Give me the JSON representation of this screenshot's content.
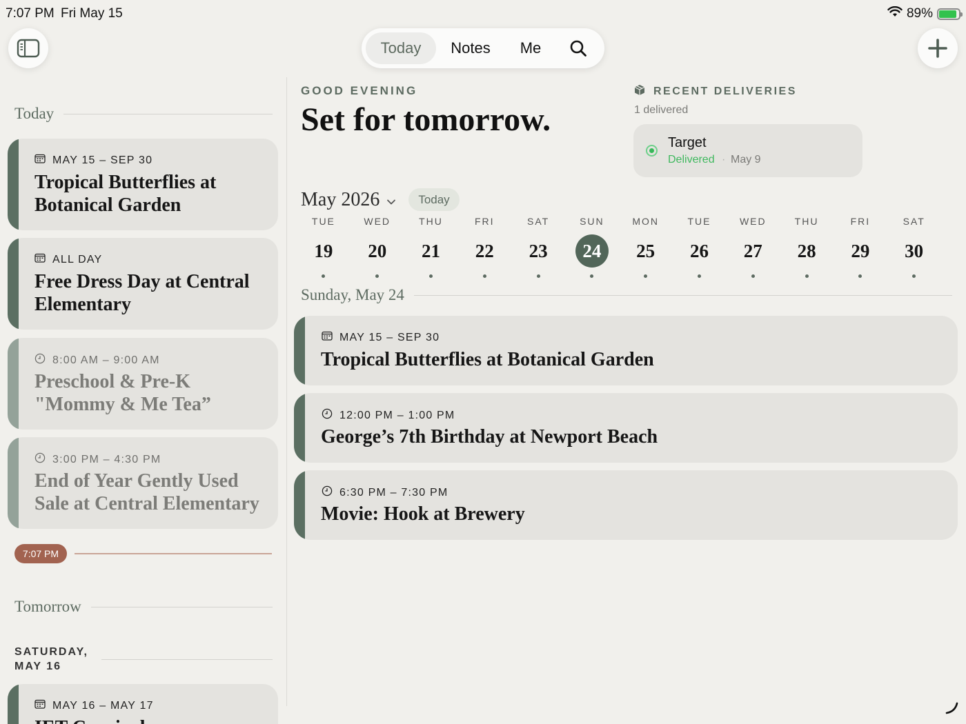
{
  "status": {
    "time": "7:07 PM",
    "date": "Fri May 15",
    "battery": "89%",
    "battery_level": 0.89
  },
  "topnav": {
    "tabs": [
      {
        "label": "Today"
      },
      {
        "label": "Notes"
      },
      {
        "label": "Me"
      }
    ]
  },
  "sidebar": {
    "today_label": "Today",
    "cards": [
      {
        "meta": "MAY 15 – SEP 30",
        "title": "Tropical Butterflies at Botanical Garden"
      },
      {
        "meta": "ALL DAY",
        "title": "Free Dress Day at Central Elementary"
      },
      {
        "meta": "8:00 AM – 9:00 AM",
        "title": "Preschool & Pre-K \"Mommy & Me Tea”"
      },
      {
        "meta": "3:00 PM – 4:30 PM",
        "title": "End of Year Gently Used Sale at Central Elementary"
      }
    ],
    "now_time": "7:07 PM",
    "tomorrow_label": "Tomorrow",
    "day_label": "SATURDAY, MAY 16",
    "next_card": {
      "meta": "MAY 16 – MAY 17",
      "title": "IET Carnival"
    }
  },
  "main": {
    "greeting": "GOOD EVENING",
    "headline": "Set for tomorrow.",
    "deliveries": {
      "heading": "RECENT DELIVERIES",
      "count": "1 delivered",
      "item": {
        "name": "Target",
        "status": "Delivered",
        "date": "May 9"
      }
    },
    "month": "May 2026",
    "today_button": "Today",
    "week": [
      {
        "day": "TUE",
        "num": "19"
      },
      {
        "day": "WED",
        "num": "20"
      },
      {
        "day": "THU",
        "num": "21"
      },
      {
        "day": "FRI",
        "num": "22"
      },
      {
        "day": "SAT",
        "num": "23"
      },
      {
        "day": "SUN",
        "num": "24"
      },
      {
        "day": "MON",
        "num": "25"
      },
      {
        "day": "TUE",
        "num": "26"
      },
      {
        "day": "WED",
        "num": "27"
      },
      {
        "day": "THU",
        "num": "28"
      },
      {
        "day": "FRI",
        "num": "29"
      },
      {
        "day": "SAT",
        "num": "30"
      }
    ],
    "selected_date": "Sunday, May 24",
    "events": [
      {
        "meta": "MAY 15 – SEP 30",
        "title": "Tropical Butterflies at Botanical Garden"
      },
      {
        "meta": "12:00 PM – 1:00 PM",
        "title": "George’s 7th Birthday at Newport Beach"
      },
      {
        "meta": "6:30 PM – 7:30 PM",
        "title": "Movie: Hook at Brewery"
      }
    ]
  },
  "colors": {
    "accent": "#5b6f62",
    "now_indicator": "#a26350",
    "delivered": "#3fb85e",
    "background": "#f1f0ec"
  }
}
